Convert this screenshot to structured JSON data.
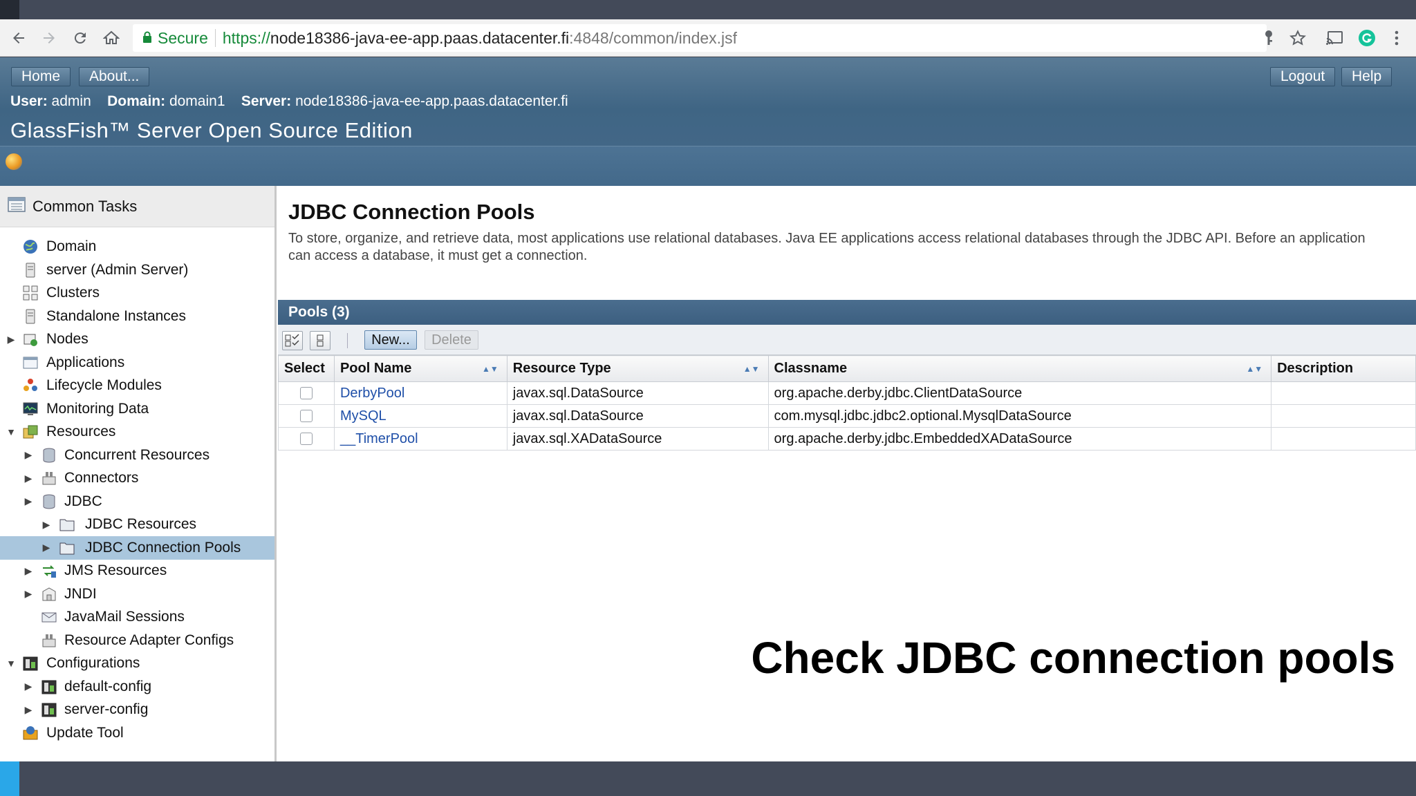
{
  "browser": {
    "secure_label": "Secure",
    "url_scheme": "https://",
    "url_host": "node18386-java-ee-app.paas.datacenter.fi",
    "url_path": ":4848/common/index.jsf"
  },
  "header": {
    "home_label": "Home",
    "about_label": "About...",
    "logout_label": "Logout",
    "help_label": "Help",
    "user_key": "User:",
    "user_value": "admin",
    "domain_key": "Domain:",
    "domain_value": "domain1",
    "server_key": "Server:",
    "server_value": "node18386-java-ee-app.paas.datacenter.fi",
    "product_name": "GlassFish™ Server Open Source Edition"
  },
  "sidebar": {
    "title": "Common Tasks",
    "items": [
      {
        "label": "Domain"
      },
      {
        "label": "server (Admin Server)"
      },
      {
        "label": "Clusters"
      },
      {
        "label": "Standalone Instances"
      },
      {
        "label": "Nodes"
      },
      {
        "label": "Applications"
      },
      {
        "label": "Lifecycle Modules"
      },
      {
        "label": "Monitoring Data"
      },
      {
        "label": "Resources"
      },
      {
        "label": "Concurrent Resources"
      },
      {
        "label": "Connectors"
      },
      {
        "label": "JDBC"
      },
      {
        "label": "JDBC Resources"
      },
      {
        "label": "JDBC Connection Pools"
      },
      {
        "label": "JMS Resources"
      },
      {
        "label": "JNDI"
      },
      {
        "label": "JavaMail Sessions"
      },
      {
        "label": "Resource Adapter Configs"
      },
      {
        "label": "Configurations"
      },
      {
        "label": "default-config"
      },
      {
        "label": "server-config"
      },
      {
        "label": "Update Tool"
      }
    ]
  },
  "main": {
    "title": "JDBC Connection Pools",
    "description": "To store, organize, and retrieve data, most applications use relational databases. Java EE applications access relational databases through the JDBC API. Before an application can access a database, it must get a connection.",
    "table_title": "Pools (3)",
    "new_label": "New...",
    "delete_label": "Delete",
    "columns": [
      "Select",
      "Pool Name",
      "Resource Type",
      "Classname",
      "Description"
    ],
    "rows": [
      {
        "name": "DerbyPool",
        "type": "javax.sql.DataSource",
        "classname": "org.apache.derby.jdbc.ClientDataSource",
        "description": ""
      },
      {
        "name": "MySQL",
        "type": "javax.sql.DataSource",
        "classname": "com.mysql.jdbc.jdbc2.optional.MysqlDataSource",
        "description": ""
      },
      {
        "name": "__TimerPool",
        "type": "javax.sql.XADataSource",
        "classname": "org.apache.derby.jdbc.EmbeddedXADataSource",
        "description": ""
      }
    ]
  },
  "caption": "Check JDBC connection pools"
}
